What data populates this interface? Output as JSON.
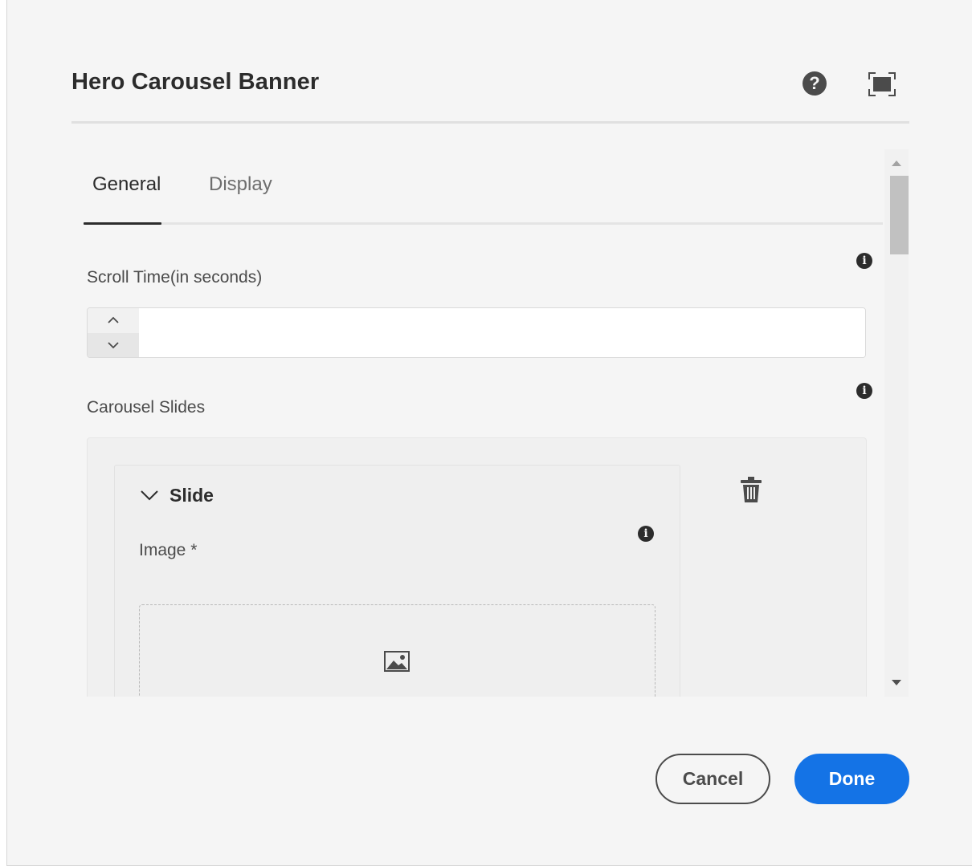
{
  "dialog": {
    "title": "Hero Carousel Banner",
    "help_label": "?",
    "tabs": [
      {
        "label": "General",
        "active": true
      },
      {
        "label": "Display",
        "active": false
      }
    ]
  },
  "general": {
    "scroll_time": {
      "label": "Scroll Time(in seconds)",
      "value": ""
    },
    "carousel_slides": {
      "label": "Carousel Slides",
      "slides": [
        {
          "title": "Slide",
          "image_label": "Image *"
        }
      ]
    },
    "info_glyph": "i"
  },
  "footer": {
    "cancel_label": "Cancel",
    "done_label": "Done"
  },
  "colors": {
    "accent": "#1473e6",
    "background": "#f5f5f5",
    "text": "#2c2c2c"
  },
  "icons": [
    "help-icon",
    "fullscreen-icon",
    "info-icon",
    "chevron-up-icon",
    "chevron-down-icon",
    "trash-icon",
    "image-icon",
    "scroll-up-arrow",
    "scroll-down-arrow"
  ]
}
